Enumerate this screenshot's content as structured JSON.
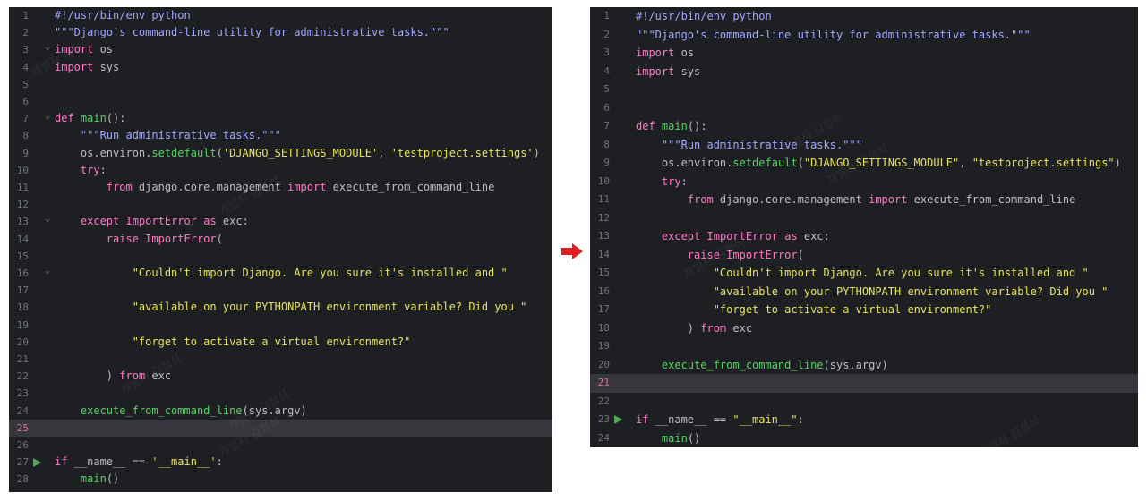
{
  "watermark": "개발자 김정식",
  "arrow_color": "#e02020",
  "left": {
    "highlight_line": "25",
    "lines": [
      {
        "n": "1",
        "t": "#!/usr/bin/env python"
      },
      {
        "n": "2",
        "t": "\"\"\"Django's command-line utility for administrative tasks.\"\"\""
      },
      {
        "n": "3",
        "t": "import os"
      },
      {
        "n": "4",
        "t": "import sys"
      },
      {
        "n": "5",
        "t": ""
      },
      {
        "n": "6",
        "t": ""
      },
      {
        "n": "7",
        "t": "def main():"
      },
      {
        "n": "8",
        "t": "    \"\"\"Run administrative tasks.\"\"\""
      },
      {
        "n": "9",
        "t": "    os.environ.setdefault('DJANGO_SETTINGS_MODULE', 'testproject.settings')"
      },
      {
        "n": "10",
        "t": "    try:"
      },
      {
        "n": "11",
        "t": "        from django.core.management import execute_from_command_line"
      },
      {
        "n": "12",
        "t": ""
      },
      {
        "n": "13",
        "t": "    except ImportError as exc:"
      },
      {
        "n": "14",
        "t": "        raise ImportError("
      },
      {
        "n": "15",
        "t": ""
      },
      {
        "n": "16",
        "t": "            \"Couldn't import Django. Are you sure it's installed and \""
      },
      {
        "n": "17",
        "t": ""
      },
      {
        "n": "18",
        "t": "            \"available on your PYTHONPATH environment variable? Did you \""
      },
      {
        "n": "19",
        "t": ""
      },
      {
        "n": "20",
        "t": "            \"forget to activate a virtual environment?\""
      },
      {
        "n": "21",
        "t": ""
      },
      {
        "n": "22",
        "t": "        ) from exc"
      },
      {
        "n": "23",
        "t": ""
      },
      {
        "n": "24",
        "t": "    execute_from_command_line(sys.argv)"
      },
      {
        "n": "25",
        "t": ""
      },
      {
        "n": "26",
        "t": ""
      },
      {
        "n": "27",
        "t": "if __name__ == '__main__':"
      },
      {
        "n": "28",
        "t": "    main()"
      }
    ]
  },
  "right": {
    "highlight_line": "21",
    "lines": [
      {
        "n": "1",
        "t": "#!/usr/bin/env python"
      },
      {
        "n": "2",
        "t": "\"\"\"Django's command-line utility for administrative tasks.\"\"\""
      },
      {
        "n": "3",
        "t": "import os"
      },
      {
        "n": "4",
        "t": "import sys"
      },
      {
        "n": "5",
        "t": ""
      },
      {
        "n": "6",
        "t": ""
      },
      {
        "n": "7",
        "t": "def main():"
      },
      {
        "n": "8",
        "t": "    \"\"\"Run administrative tasks.\"\"\""
      },
      {
        "n": "9",
        "t": "    os.environ.setdefault(\"DJANGO_SETTINGS_MODULE\", \"testproject.settings\")"
      },
      {
        "n": "10",
        "t": "    try:"
      },
      {
        "n": "11",
        "t": "        from django.core.management import execute_from_command_line"
      },
      {
        "n": "12",
        "t": ""
      },
      {
        "n": "13",
        "t": "    except ImportError as exc:"
      },
      {
        "n": "14",
        "t": "        raise ImportError("
      },
      {
        "n": "15",
        "t": "            \"Couldn't import Django. Are you sure it's installed and \""
      },
      {
        "n": "16",
        "t": "            \"available on your PYTHONPATH environment variable? Did you \""
      },
      {
        "n": "17",
        "t": "            \"forget to activate a virtual environment?\""
      },
      {
        "n": "18",
        "t": "        ) from exc"
      },
      {
        "n": "19",
        "t": ""
      },
      {
        "n": "20",
        "t": "    execute_from_command_line(sys.argv)"
      },
      {
        "n": "21",
        "t": ""
      },
      {
        "n": "22",
        "t": ""
      },
      {
        "n": "23",
        "t": "if __name__ == \"__main__\":"
      },
      {
        "n": "24",
        "t": "    main()"
      }
    ]
  }
}
